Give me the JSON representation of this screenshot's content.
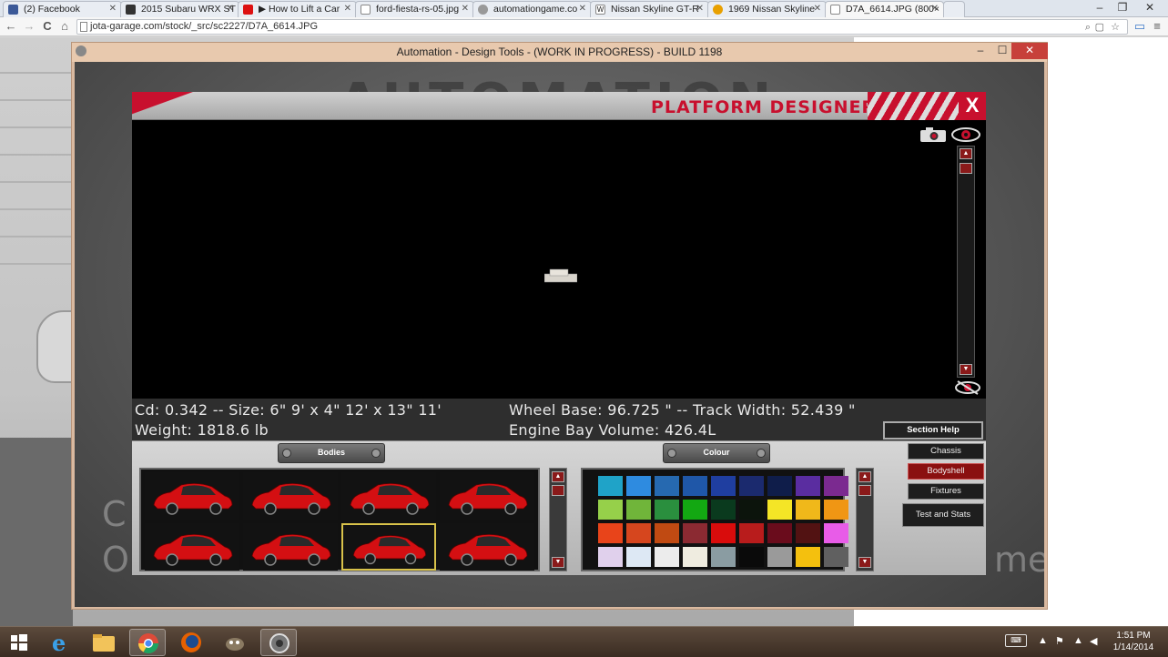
{
  "browser": {
    "tabs": [
      {
        "label": "(2) Facebook",
        "color": "#3b5998"
      },
      {
        "label": "2015 Subaru WRX ST",
        "color": "#333333"
      },
      {
        "label": "▶ How to Lift a Car",
        "color": "#d11"
      },
      {
        "label": "ford-fiesta-rs-05.jpg",
        "color": "#ffffff"
      },
      {
        "label": "automationgame.co",
        "color": "#888888"
      },
      {
        "label": "Nissan Skyline GT-R",
        "color": "#ffffff"
      },
      {
        "label": "1969 Nissan Skyline",
        "color": "#e8a000"
      },
      {
        "label": "D7A_6614.JPG (800×",
        "color": "#ffffff",
        "active": true
      }
    ],
    "address": "jota-garage.com/stock/_src/sc2227/D7A_6614.JPG",
    "window_controls": {
      "minimize": "–",
      "restore": "❐",
      "close": "✕"
    },
    "nav": {
      "back": "←",
      "forward": "→",
      "reload": "C",
      "home": "⌂"
    }
  },
  "game_window": {
    "title": "Automation - Design Tools - (WORK IN PROGRESS) - BUILD 1198",
    "controls": {
      "minimize": "–",
      "maximize": "☐",
      "close": "✕"
    }
  },
  "designer": {
    "title": "PLATFORM DESIGNER",
    "close_label": "X",
    "stats": {
      "cd_size": "Cd: 0.342 -- Size: 6\" 9' x 4\" 12' x 13\" 11'",
      "weight": "Weight: 1818.6 lb",
      "wheelbase": "Wheel Base: 96.725 \" -- Track Width: 52.439 \"",
      "engine_bay": "Engine Bay Volume: 426.4L"
    },
    "bodies_label": "Bodies",
    "colour_label": "Colour",
    "section_help": "Section Help",
    "nav_tabs": [
      {
        "label": "Chassis",
        "active": false
      },
      {
        "label": "Bodyshell",
        "active": true
      },
      {
        "label": "Fixtures",
        "active": false
      },
      {
        "label": "Test and Stats",
        "active": false
      }
    ],
    "bodies_selected_index": 6,
    "bodies_count": 8,
    "colours": [
      "#1fa3c8",
      "#2e8be0",
      "#2669b0",
      "#1f57a8",
      "#1f3ea0",
      "#1b2a6e",
      "#0f1d4a",
      "#5a2da0",
      "#7b2a90",
      "#96d04a",
      "#70b53a",
      "#2a8f3e",
      "#13a812",
      "#0a3a1e",
      "#0c140c",
      "#f4e526",
      "#f0b81a",
      "#f09614",
      "#e8441a",
      "#d6461e",
      "#c04a12",
      "#8b2a32",
      "#d90c0c",
      "#b81c1c",
      "#6a0c1c",
      "#521212",
      "#e85ce8",
      "#e0d0ec",
      "#dde8f4",
      "#ececec",
      "#efece0",
      "#8a9ca2",
      "#0a0a0a",
      "#9a9a9a",
      "#f4c00e",
      "#606060"
    ]
  },
  "taskbar": {
    "clock_time": "1:51 PM",
    "clock_date": "1/14/2014"
  }
}
